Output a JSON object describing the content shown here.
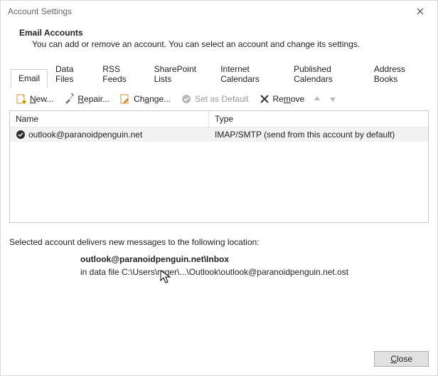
{
  "window_title": "Account Settings",
  "header": {
    "title": "Email Accounts",
    "subtitle": "You can add or remove an account. You can select an account and change its settings."
  },
  "tabs": {
    "items": [
      {
        "label": "Email"
      },
      {
        "label": "Data Files"
      },
      {
        "label": "RSS Feeds"
      },
      {
        "label": "SharePoint Lists"
      },
      {
        "label": "Internet Calendars"
      },
      {
        "label": "Published Calendars"
      },
      {
        "label": "Address Books"
      }
    ]
  },
  "toolbar": {
    "new_label": "New...",
    "repair_label": "Repair...",
    "change_label": "Change...",
    "default_label": "Set as Default",
    "remove_label": "Remove"
  },
  "columns": {
    "name": "Name",
    "type": "Type"
  },
  "accounts": [
    {
      "name": "outlook@paranoidpenguin.net",
      "type": "IMAP/SMTP (send from this account by default)"
    }
  ],
  "info": {
    "line1": "Selected account delivers new messages to the following location:",
    "line2": "outlook@paranoidpenguin.net\\Inbox",
    "line3": "in data file C:\\Users\\roger\\...\\Outlook\\outlook@paranoidpenguin.net.ost"
  },
  "footer": {
    "close_label": "Close"
  }
}
